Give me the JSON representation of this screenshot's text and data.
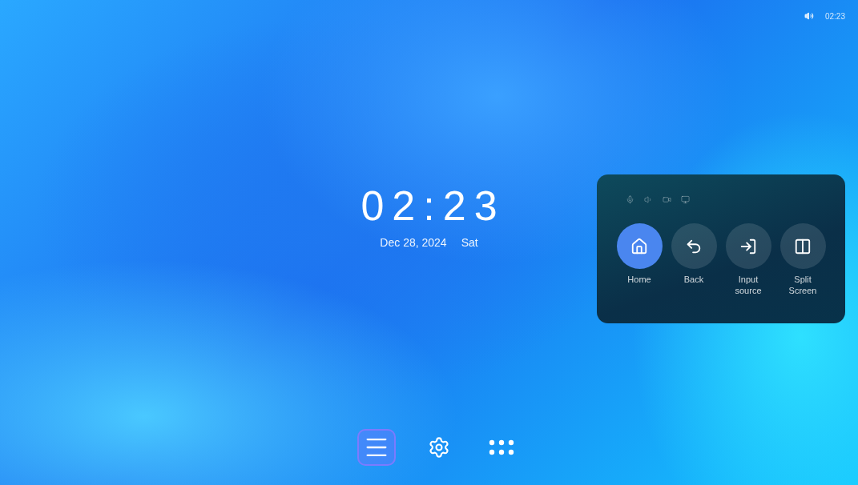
{
  "status_bar": {
    "time": "02:23"
  },
  "clock": {
    "time": "02:23",
    "date": "Dec 28, 2024",
    "weekday": "Sat"
  },
  "quick_panel": {
    "buttons": [
      {
        "kind": "home",
        "label": "Home",
        "selected": true
      },
      {
        "kind": "back",
        "label": "Back",
        "selected": false
      },
      {
        "kind": "input",
        "label": "Input source",
        "selected": false
      },
      {
        "kind": "split",
        "label": "Split Screen",
        "selected": false
      }
    ]
  },
  "dock": {
    "items": [
      {
        "kind": "menu",
        "selected": true
      },
      {
        "kind": "settings",
        "selected": false
      },
      {
        "kind": "apps",
        "selected": false
      }
    ]
  }
}
